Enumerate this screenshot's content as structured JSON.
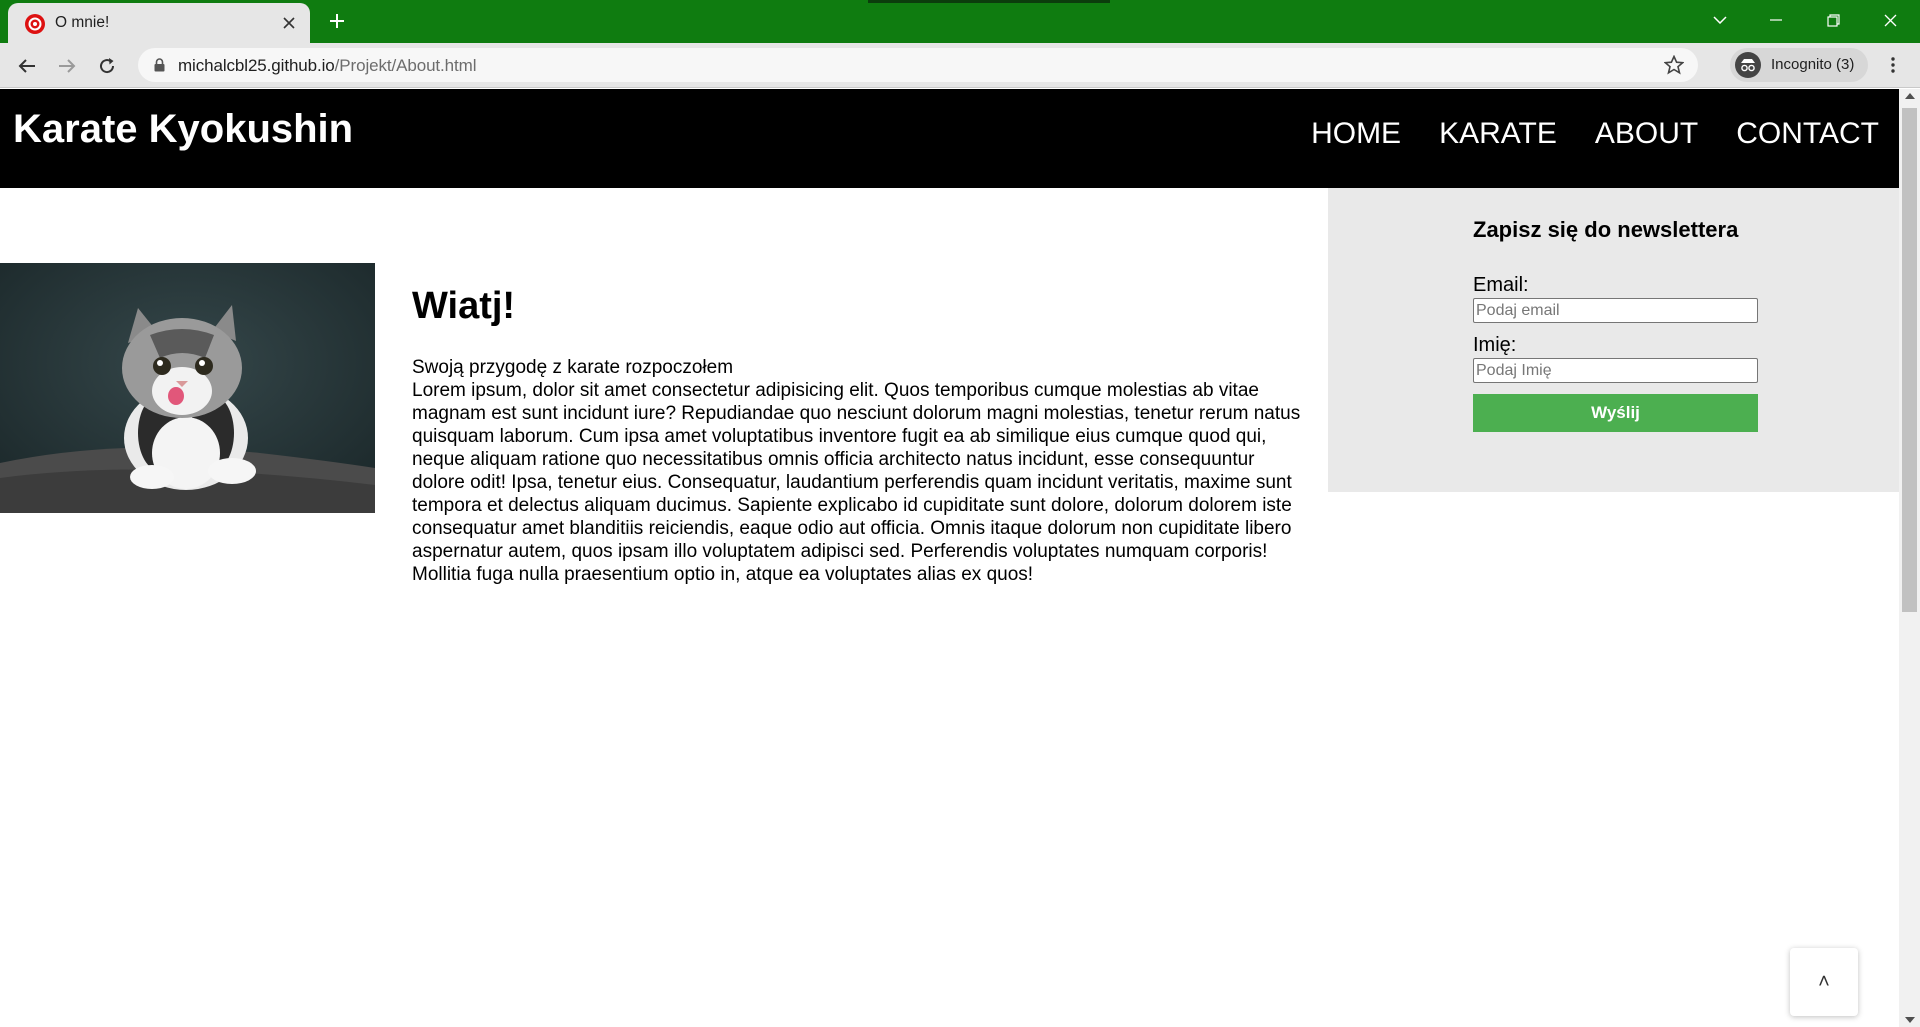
{
  "browser": {
    "tab": {
      "title": "O mnie!",
      "favicon": "karate-logo-icon"
    },
    "address": {
      "host": "michalcbl25.github.io",
      "path": "/Projekt/About.html"
    },
    "incognito_label": "Incognito (3)"
  },
  "site": {
    "title": "Karate Kyokushin",
    "nav": [
      {
        "label": "HOME"
      },
      {
        "label": "KARATE"
      },
      {
        "label": "ABOUT"
      },
      {
        "label": "CONTACT"
      }
    ]
  },
  "article": {
    "image": "kitten-photo",
    "heading": "Wiatj!",
    "intro": "Swoją przygodę z karate rozpoczołem",
    "body": "Lorem ipsum, dolor sit amet consectetur adipisicing elit. Quos temporibus cumque molestias ab vitae magnam est sunt incidunt iure? Repudiandae quo nesciunt dolorum magni molestias, tenetur rerum natus quisquam laborum. Cum ipsa amet voluptatibus inventore fugit ea ab similique eius cumque quod qui, neque aliquam ratione quo necessitatibus omnis officia architecto natus incidunt, esse consequuntur dolore odit! Ipsa, tenetur eius. Consequatur, laudantium perferendis quam incidunt veritatis, maxime sunt tempora et delectus aliquam ducimus. Sapiente explicabo id cupiditate sunt dolore, dolorum dolorem iste consequatur amet blanditiis reiciendis, eaque odio aut officia. Omnis itaque dolorum non cupiditate libero aspernatur autem, quos ipsam illo voluptatem adipisci sed. Perferendis voluptates numquam corporis! Mollitia fuga nulla praesentium optio in, atque ea voluptates alias ex quos!"
  },
  "newsletter": {
    "heading": "Zapisz się do newslettera",
    "email_label": "Email:",
    "email_placeholder": "Podaj email",
    "name_label": "Imię:",
    "name_placeholder": "Podaj Imię",
    "submit_label": "Wyślij"
  },
  "scroll_to_top_label": "˄",
  "colors": {
    "chrome_frame": "#0f7c10",
    "header_bg": "#000000",
    "aside_bg": "#e9e9e9",
    "button": "#4caf50"
  }
}
